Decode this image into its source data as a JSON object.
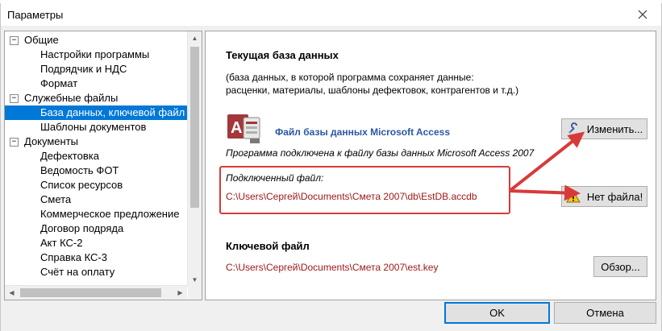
{
  "window": {
    "title": "Параметры"
  },
  "tree": {
    "items": [
      {
        "label": "Общие",
        "level": 0,
        "expanded": true
      },
      {
        "label": "Настройки программы",
        "level": 1
      },
      {
        "label": "Подрядчик и НДС",
        "level": 1
      },
      {
        "label": "Формат",
        "level": 1
      },
      {
        "label": "Служебные файлы",
        "level": 0,
        "expanded": true
      },
      {
        "label": "База данных, ключевой файл",
        "level": 1,
        "selected": true
      },
      {
        "label": "Шаблоны документов",
        "level": 1
      },
      {
        "label": "Документы",
        "level": 0,
        "expanded": true
      },
      {
        "label": "Дефектовка",
        "level": 1
      },
      {
        "label": "Ведомость ФОТ",
        "level": 1
      },
      {
        "label": "Список ресурсов",
        "level": 1
      },
      {
        "label": "Смета",
        "level": 1
      },
      {
        "label": "Коммерческое предложение",
        "level": 1
      },
      {
        "label": "Договор подряда",
        "level": 1
      },
      {
        "label": "Акт КС-2",
        "level": 1
      },
      {
        "label": "Справка КС-3",
        "level": 1
      },
      {
        "label": "Счёт на оплату",
        "level": 1
      }
    ]
  },
  "db": {
    "title": "Текущая база данных",
    "desc_line1": "(база данных, в которой программа сохраняет данные:",
    "desc_line2": "расценки, материалы, шаблоны дефектовок, контрагентов и т.д.)",
    "access_label": "Файл базы данных Microsoft Access",
    "connected_text": "Программа подключена к файлу базы данных Microsoft Access 2007",
    "connected_label": "Подключенный файл:",
    "connected_path": "C:\\Users\\Сергей\\Documents\\Смета 2007\\db\\EstDB.accdb",
    "change_button": "Изменить...",
    "nofile_button": "Нет файла!"
  },
  "key": {
    "title": "Ключевой файл",
    "path": "C:\\Users\\Сергей\\Documents\\Смета 2007\\est.key",
    "browse_button": "Обзор..."
  },
  "footer": {
    "ok": "OK",
    "cancel": "Отмена"
  },
  "colors": {
    "selection": "#0078d7",
    "path_red": "#a01818",
    "annotation_red": "#d83a3a",
    "link_blue": "#2a56a8"
  }
}
